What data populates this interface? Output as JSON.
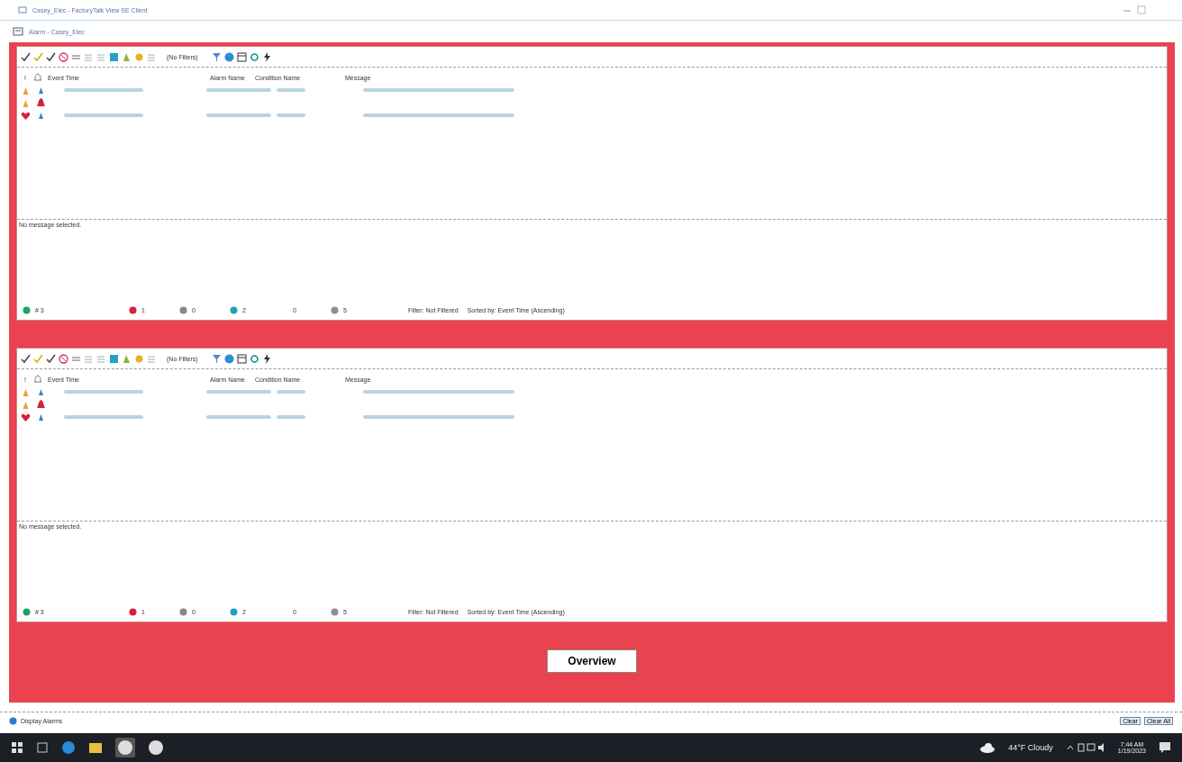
{
  "window": {
    "title": "Casey_Elec - FactoryTalk View SE Client"
  },
  "display": {
    "title": "Alarm - Casey_Elec"
  },
  "panels": [
    {
      "filter_label": "(No Filters)",
      "columns": [
        "!",
        "Event Time",
        "Alarm Name",
        "Condition Name",
        "Message"
      ],
      "rows": [
        {
          "urgent": false,
          "bell": false,
          "details_shown": true
        },
        {
          "urgent": false,
          "bell": true,
          "details_shown": false
        },
        {
          "urgent": true,
          "bell": false,
          "details_shown": true
        }
      ],
      "detail": "No message selected.",
      "counts": [
        {
          "kind": "total",
          "text": "# 3"
        },
        {
          "kind": "in_alarm",
          "text": "1"
        },
        {
          "kind": "unacked",
          "text": "0"
        },
        {
          "kind": "normal",
          "text": "2"
        },
        {
          "kind": "blank",
          "text": "0"
        },
        {
          "kind": "disabled",
          "text": "5"
        }
      ],
      "filter": "Filter: Not Filtered",
      "sort": "Sorted by: Event Time (Ascending)"
    },
    {
      "filter_label": "(No Filters)",
      "columns": [
        "!",
        "Event Time",
        "Alarm Name",
        "Condition Name",
        "Message"
      ],
      "rows": [
        {
          "urgent": false,
          "bell": false,
          "details_shown": true
        },
        {
          "urgent": false,
          "bell": true,
          "details_shown": false
        },
        {
          "urgent": true,
          "bell": false,
          "details_shown": true
        }
      ],
      "detail": "No message selected.",
      "counts": [
        {
          "kind": "total",
          "text": "# 3"
        },
        {
          "kind": "in_alarm",
          "text": "1"
        },
        {
          "kind": "unacked",
          "text": "0"
        },
        {
          "kind": "normal",
          "text": "2"
        },
        {
          "kind": "blank",
          "text": "0"
        },
        {
          "kind": "disabled",
          "text": "5"
        }
      ],
      "filter": "Filter: Not Filtered",
      "sort": "Sorted by: Event Time (Ascending)"
    }
  ],
  "overview_button": "Overview",
  "status_bar": {
    "text": "Display Alarms",
    "buttons": [
      "Clear",
      "Clear All"
    ]
  },
  "taskbar": {
    "weather": "44°F Cloudy",
    "time": "7:44 AM",
    "date": "1/19/2023"
  }
}
